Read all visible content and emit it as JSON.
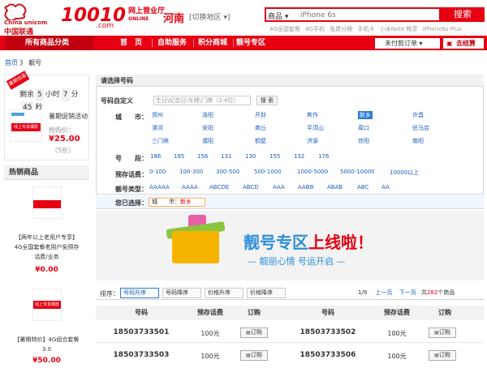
{
  "header": {
    "logo_cn": "中国联通",
    "logo_en": "China unicom",
    "hotline": "10010",
    "hotline_com": ".com",
    "hotline_sub_1": "网上营业厅",
    "hotline_sub_2": "ONLINE",
    "region": "河南",
    "region_switch": "[切换地区 ▾]",
    "search": {
      "category": "商品 ▾",
      "placeholder": "iPhone 6s",
      "button": "搜索"
    },
    "hot_links": [
      "4G全国套餐",
      "4G手机",
      "免费分期",
      "手机卡",
      "小米Note 畅享",
      "iPhone6s Plus"
    ]
  },
  "nav": {
    "all_categories": "所有商品分类",
    "items": [
      "首　页",
      "自助服务",
      "积分商城",
      "靓号专区"
    ],
    "order_button": "未付款订单 ▾",
    "cart_button": "去结算"
  },
  "breadcrumb": {
    "home": "首页",
    "sep": " 》",
    "current": "靓号"
  },
  "promo": {
    "ribbon": "暑期惊喜",
    "countdown_prefix": "剩余",
    "days": "5",
    "days_unit": "小时",
    "hours": "7",
    "hours_unit": "分",
    "minutes": "45",
    "minutes_unit": "秒",
    "title": "暑期促销活动",
    "price_label": "抢购价：",
    "price": "¥25.00",
    "discount": "（5折）",
    "thumb_text": "线上专享爆款"
  },
  "hot_products": {
    "header": "热销商品",
    "items": [
      {
        "title_1": "【两年以上老用户专享】",
        "title_2": "4G全国套餐老用户免预存",
        "title_3": "话费/业务",
        "price": "¥0.00"
      },
      {
        "title_1": "【暑期特价】4G组合套餐",
        "title_2": "3.0",
        "title_3": "",
        "price": "¥50.00",
        "thumb_text": "线上专享爆款"
      }
    ]
  },
  "panel": {
    "header": "请选择号码",
    "custom_label": "号码自定义",
    "custom_placeholder": "生日\\纪念日\\车牌\\门牌（2-4位）",
    "custom_button": "搜 索",
    "city_label": "城　　市：",
    "cities_row1": [
      "郑州",
      "洛阳",
      "开封",
      "焦作",
      "新乡",
      "许昌"
    ],
    "cities_row2": [
      "漯河",
      "安阳",
      "商丘",
      "平顶山",
      "周口",
      "驻马店"
    ],
    "cities_row3": [
      "三门峡",
      "濮阳",
      "鹤壁",
      "济源",
      "信阳",
      "南阳"
    ],
    "selected_city": "新乡",
    "segment_label": "号　　段：",
    "segments": [
      "186",
      "185",
      "156",
      "131",
      "130",
      "155",
      "132",
      "176"
    ],
    "prestore_label": "预存话费：",
    "prestore": [
      "0-100",
      "100-300",
      "300-500",
      "500-1000",
      "1000-5000",
      "5000-10000",
      "10000以上"
    ],
    "type_label": "靓号类型：",
    "types": [
      "AAAAA",
      "AAAA",
      "ABCDE",
      "ABCD",
      "AAA",
      "AABB",
      "ABAB",
      "ABC",
      "AA"
    ],
    "chosen_label": "您已选择：",
    "chosen_city": "城　　市：",
    "chosen_value": "新乡"
  },
  "banner": {
    "title_blue": "靓号专区",
    "title_red": "上线啦！",
    "subtitle": "— 靓丽心情 号运开启 —"
  },
  "sortbar": {
    "label": "排序：",
    "buttons": [
      "号码升序",
      "号码降序",
      "价格升序",
      "价格降序"
    ],
    "page": "1/9",
    "prev": "上一页",
    "next": "下一页",
    "total_prefix": "共",
    "total": "282",
    "total_suffix": "个商品"
  },
  "table": {
    "headers": [
      "号码",
      "预存话费",
      "订购"
    ],
    "order_button": "订购",
    "rows": [
      {
        "left_number": "18503733501",
        "left_fee": "100元",
        "right_number": "18503733502",
        "right_fee": "100元"
      },
      {
        "left_number": "18503733503",
        "left_fee": "100元",
        "right_number": "18503733506",
        "right_fee": "100元"
      }
    ]
  }
}
